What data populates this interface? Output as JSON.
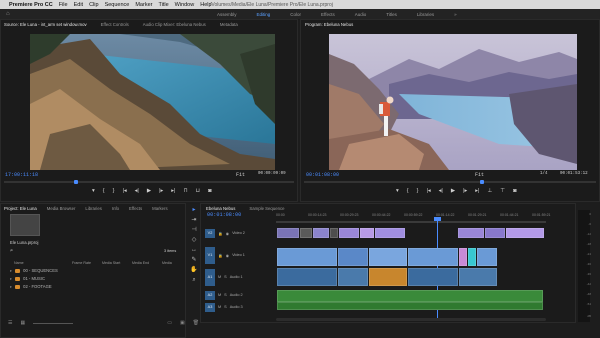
{
  "mac_menu": {
    "app": "Premiere Pro CC",
    "items": [
      "File",
      "Edit",
      "Clip",
      "Sequence",
      "Marker",
      "Title",
      "Window",
      "Help"
    ],
    "path": "/Volumes/Media/Ele Luna/Premiere Pro/Ele Luna.prproj"
  },
  "workspaces": {
    "tabs": [
      "Assembly",
      "Editing",
      "Color",
      "Effects",
      "Audio",
      "Titles",
      "Libraries"
    ],
    "active": "Editing"
  },
  "source_monitor": {
    "tabs": [
      "Source: Ele Luna - int_arm set window.mov",
      "Effect Controls",
      "Audio Clip Mixer: Ebeluna Nebus",
      "Metadata"
    ],
    "timecode_left": "17:00:11:18",
    "fit": "Fit",
    "timecode_right": "00:00:09:09"
  },
  "program_monitor": {
    "tabs": [
      "Program: Ebeluna Nebus"
    ],
    "timecode_left": "00:01:08:00",
    "fit": "Fit",
    "scale": "1/4",
    "timecode_right": "00:01:53:12"
  },
  "transport": {
    "icons": [
      "marker",
      "in",
      "out",
      "go-in",
      "step-back",
      "play",
      "step-fwd",
      "go-out",
      "insert",
      "overwrite",
      "export"
    ]
  },
  "project_panel": {
    "tabs": [
      "Project: Ele Luna",
      "Media Browser",
      "Libraries",
      "Info",
      "Effects",
      "Markers"
    ],
    "project_name": "Ele Luna.prproj",
    "count": "3 items",
    "columns": [
      "Name",
      "Frame Rate",
      "Media Start",
      "Media End",
      "Media"
    ],
    "items": [
      "00 - SEQUENCES",
      "01 - MUSIC",
      "02 - FOOTAGE"
    ]
  },
  "timeline": {
    "tabs": [
      "Ebeluna Nebus",
      "Sample Sequence"
    ],
    "timecode": "00:01:08:00",
    "ruler": [
      "00:00",
      "00:00:14:23",
      "00:00:29:23",
      "00:00:44:22",
      "00:00:59:22",
      "00:01:14:22",
      "00:01:29:21",
      "00:01:44:21",
      "00:01:59:21"
    ],
    "tracks": [
      {
        "id": "V2",
        "name": "Video 2"
      },
      {
        "id": "V1",
        "name": "Video 1"
      },
      {
        "id": "A1",
        "name": "Audio 1"
      },
      {
        "id": "A2",
        "name": "Audio 2"
      },
      {
        "id": "A3",
        "name": "Audio 3"
      }
    ]
  },
  "meter": {
    "scale": [
      "0",
      "-6",
      "-12",
      "-18",
      "-24",
      "-30",
      "-36",
      "-42",
      "-48",
      "-54",
      "dB"
    ]
  },
  "colors": {
    "accent": "#4a8cff",
    "clip_video_purple": "#9a86d8",
    "clip_video_blue": "#6a9ad6",
    "clip_audio_green": "#3a8a3a",
    "clip_audio_orange": "#c8862d",
    "folder": "#d88c2d"
  }
}
